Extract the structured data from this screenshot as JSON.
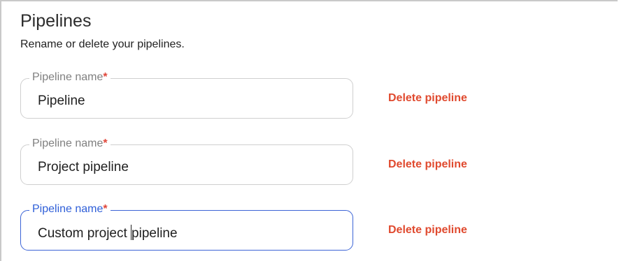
{
  "section": {
    "title": "Pipelines",
    "subtitle": "Rename or delete your pipelines."
  },
  "pipelines": [
    {
      "label": "Pipeline name",
      "required_mark": "*",
      "value": "Pipeline",
      "delete_label": "Delete pipeline",
      "focused": false
    },
    {
      "label": "Pipeline name",
      "required_mark": "*",
      "value": "Project pipeline",
      "delete_label": "Delete pipeline",
      "focused": false
    },
    {
      "label": "Pipeline name",
      "required_mark": "*",
      "value_before_caret": "Custom project ",
      "value_after_caret": "pipeline",
      "delete_label": "Delete pipeline",
      "focused": true
    }
  ],
  "colors": {
    "required": "#e0463a",
    "delete": "#e04a2f",
    "focus": "#3b64d6"
  }
}
